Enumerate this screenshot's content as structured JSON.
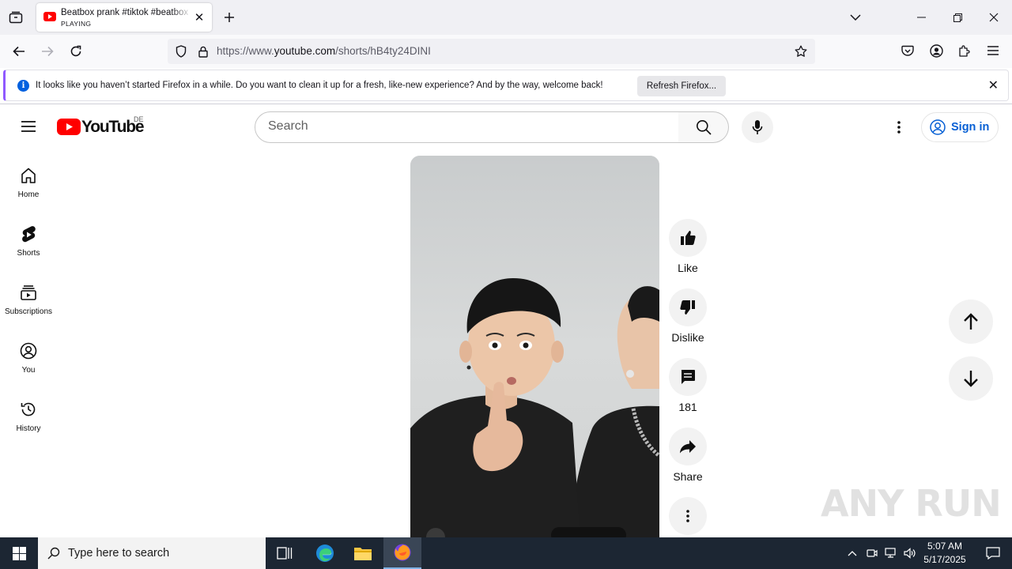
{
  "browser": {
    "tab": {
      "title": "Beatbox prank #tiktok #beatbox",
      "status": "PLAYING"
    },
    "url": {
      "prefix": "https://www.",
      "domain": "youtube.com",
      "path": "/shorts/hB4ty24DINI"
    },
    "notification": {
      "message": "It looks like you haven’t started Firefox in a while. Do you want to clean it up for a fresh, like-new experience? And by the way, welcome back!",
      "button": "Refresh Firefox..."
    }
  },
  "youtube": {
    "logo_text": "YouTube",
    "country_code": "DE",
    "search_placeholder": "Search",
    "sign_in": "Sign in",
    "guide": [
      {
        "label": "Home",
        "icon": "home-icon"
      },
      {
        "label": "Shorts",
        "icon": "shorts-icon"
      },
      {
        "label": "Subscriptions",
        "icon": "subscriptions-icon"
      },
      {
        "label": "You",
        "icon": "you-icon"
      },
      {
        "label": "History",
        "icon": "history-icon"
      }
    ],
    "actions": {
      "like": "Like",
      "dislike": "Dislike",
      "comments": "181",
      "share": "Share"
    }
  },
  "watermark": "ANY RUN",
  "taskbar": {
    "search_placeholder": "Type here to search",
    "time": "5:07 AM",
    "date": "5/17/2025"
  },
  "colors": {
    "youtube_red": "#ff0000",
    "link_blue": "#065fd4",
    "taskbar": "#1c2633",
    "firefox_accent": "#9059ff"
  }
}
